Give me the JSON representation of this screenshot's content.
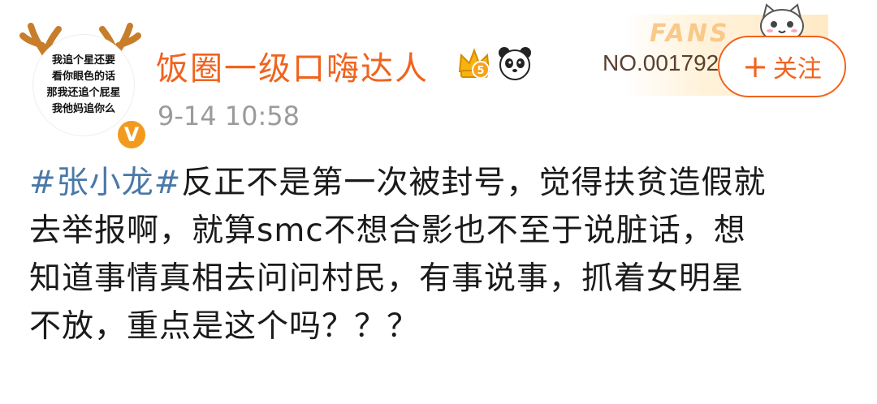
{
  "user": {
    "avatar_text": [
      "我追个星还要",
      "看你眼色的话",
      "那我还追个屁星",
      "我他妈追你么"
    ],
    "verified_badge": "V",
    "name": "饭圈一级口嗨达人",
    "crown_level": "5",
    "timestamp": "9-14 10:58"
  },
  "fans": {
    "label": "FANS",
    "number": "NO.001792"
  },
  "follow_button": {
    "plus": "+",
    "label": "关注"
  },
  "post": {
    "hashtag": "#张小龙#",
    "line1_rest": "反正不是第一次被封号，觉得扶贫造假就",
    "line2": "去举报啊，就算smc不想合影也不至于说脏话，想",
    "line3": "知道事情真相去问问村民，有事说事，抓着女明星",
    "line4": "不放，重点是这个吗？？？"
  },
  "colors": {
    "accent": "#f0631e",
    "hashtag": "#4a78a8",
    "timestamp": "#9b9b9b",
    "badge": "#f29a1e"
  },
  "icons": [
    "antler-icon",
    "verified-badge-icon",
    "crown-icon",
    "panda-icon",
    "cat-icon",
    "plus-icon"
  ]
}
